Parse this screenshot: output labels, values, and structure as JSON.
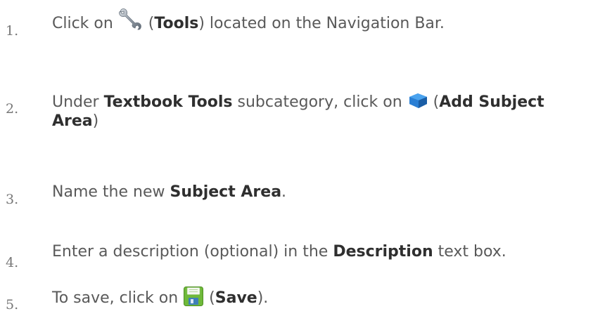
{
  "steps": [
    {
      "number": "1.",
      "before": "Click on ",
      "icon": "wrench-icon",
      "open": " (",
      "bold": "Tools",
      "after": ") located on the Navigation Bar."
    },
    {
      "number": "2.",
      "before": "Under ",
      "bold1": "Textbook Tools",
      "middle": " subcategory, click on ",
      "icon": "book-icon",
      "open": " (",
      "bold2": "Add Subject Area",
      "after": ")"
    },
    {
      "number": "3.",
      "before": "Name the new ",
      "bold": "Subject Area",
      "after": "."
    },
    {
      "number": "4.",
      "before": "Enter a description (optional) in the ",
      "bold": "Description",
      "after": " text box."
    },
    {
      "number": "5.",
      "before": "To save, click on ",
      "icon": "save-icon",
      "open": " (",
      "bold": "Save",
      "after": ")."
    }
  ],
  "colors": {
    "text": "#595959",
    "bold": "#2f2f2f",
    "number": "#777777",
    "wrench": "#9aa3ad",
    "book": "#2a7fd4",
    "save": "#7cc242"
  }
}
